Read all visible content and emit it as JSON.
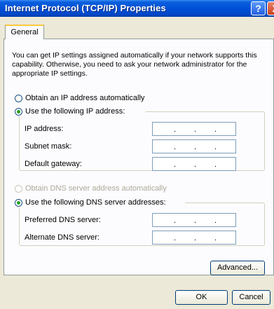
{
  "window": {
    "title": "Internet Protocol (TCP/IP) Properties",
    "help_label": "?",
    "close_label": "X"
  },
  "tabs": {
    "general": "General"
  },
  "description": "You can get IP settings assigned automatically if your network supports this capability. Otherwise, you need to ask your network administrator for the appropriate IP settings.",
  "ip_options": {
    "auto": "Obtain an IP address automatically",
    "manual": "Use the following IP address:"
  },
  "ip_fields": {
    "ip_address": "IP address:",
    "subnet_mask": "Subnet mask:",
    "default_gateway": "Default gateway:"
  },
  "dns_options": {
    "auto": "Obtain DNS server address automatically",
    "manual": "Use the following DNS server addresses:"
  },
  "dns_fields": {
    "preferred": "Preferred DNS server:",
    "alternate": "Alternate DNS server:"
  },
  "buttons": {
    "advanced": "Advanced...",
    "ok": "OK",
    "cancel": "Cancel"
  },
  "ip_dot": "."
}
